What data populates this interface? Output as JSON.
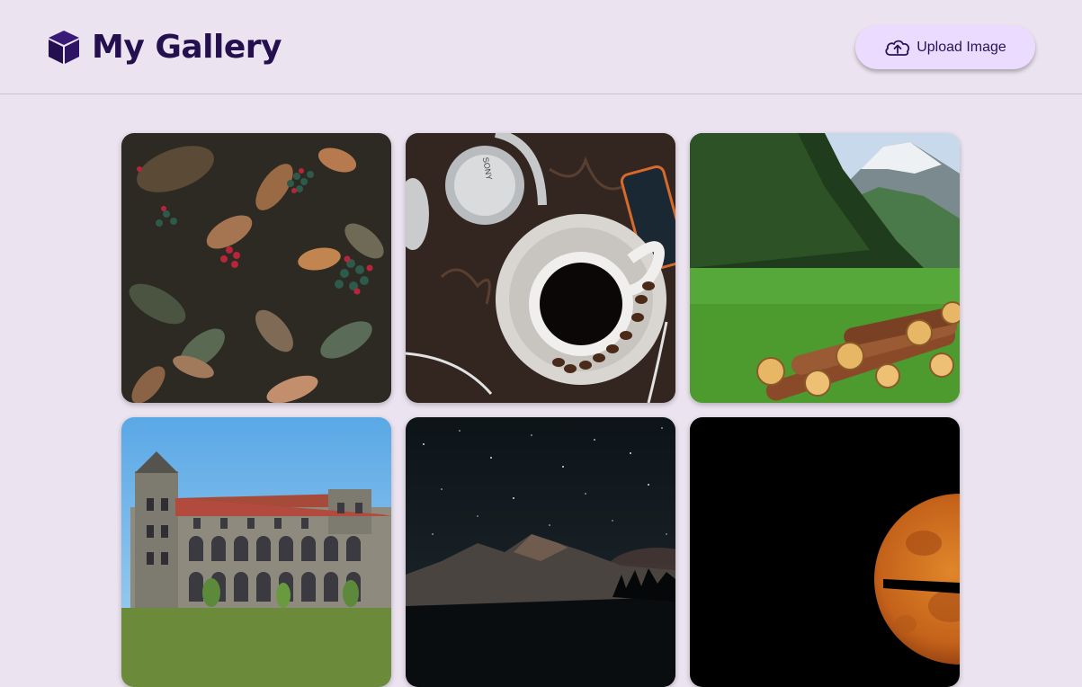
{
  "header": {
    "title": "My Gallery",
    "logo_icon": "cube-icon",
    "upload_button": {
      "label": "Upload Image",
      "icon": "cloud-upload-icon"
    }
  },
  "colors": {
    "background": "#ebe3ef",
    "title": "#24104f",
    "button_bg": "#ebdcff"
  },
  "gallery": {
    "images": [
      {
        "subject": "leaves-berries-photo"
      },
      {
        "subject": "coffee-headphones-photo",
        "brand_text": "SONY"
      },
      {
        "subject": "mountain-meadow-logs-photo"
      },
      {
        "subject": "historic-building-photo"
      },
      {
        "subject": "night-sky-mountains-photo"
      },
      {
        "subject": "orange-moon-photo"
      }
    ]
  }
}
